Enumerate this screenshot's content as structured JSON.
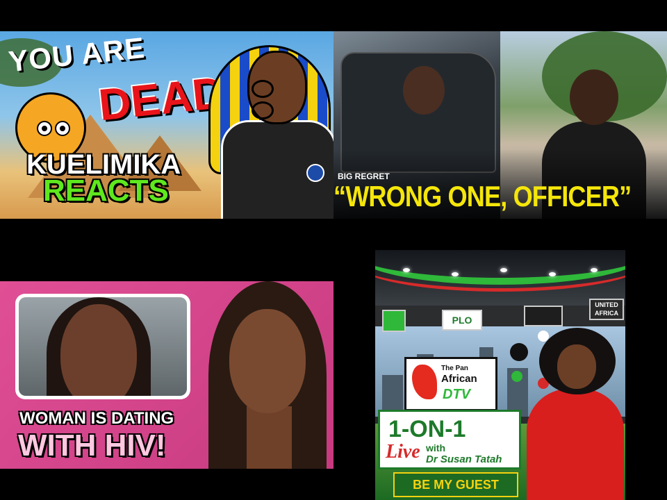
{
  "thumbnails": [
    {
      "title_line1": "YOU ARE",
      "title_line2": "DEAD",
      "brand_line1": "KUELIMIKA",
      "brand_line2": "REACTS",
      "colors": {
        "dead": "#e8141a",
        "reacts": "#5fe81d"
      }
    },
    {
      "subtitle": "BIG REGRET",
      "headline": "“WRONG ONE, OFFICER”",
      "colors": {
        "headline": "#f5e60a"
      }
    },
    {
      "line1": "WOMAN IS DATING",
      "line2": "WITH HIV!",
      "colors": {
        "background": "#e04f95",
        "line2": "#ffc8e0"
      }
    },
    {
      "logos": [
        "PLO",
        "UNITED AFRICA"
      ],
      "brand_top": "The Pan",
      "brand_mid": "African",
      "brand_bottom": "DTV",
      "show_title": "1-ON-1",
      "live": "Live",
      "with": "with",
      "host": "Dr Susan Tatah",
      "cta": "BE MY GUEST",
      "colors": {
        "green": "#1d7a2a",
        "red": "#d62a2a",
        "gold": "#f5d20f"
      }
    }
  ]
}
